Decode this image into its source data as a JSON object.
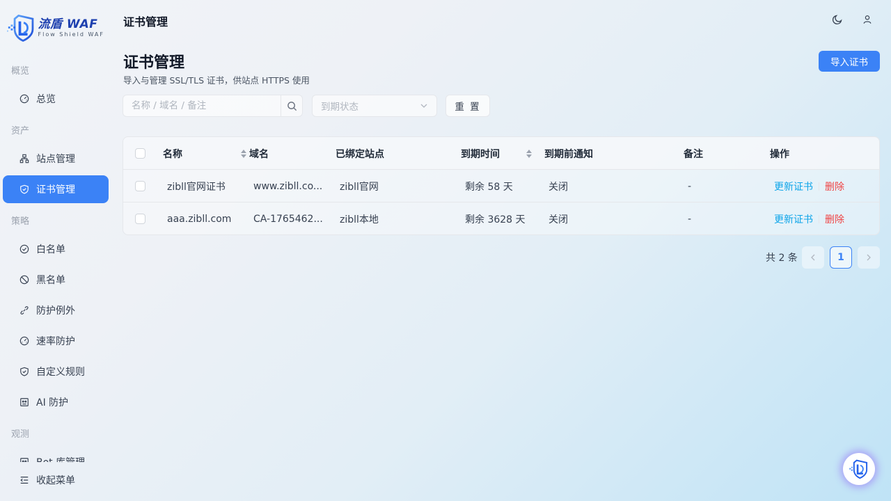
{
  "brand": {
    "title": "流盾 WAF",
    "subtitle": "Flow Shield WAF"
  },
  "sidebar": {
    "groups": [
      "概览",
      "资产",
      "策略",
      "观测"
    ],
    "items": [
      {
        "label": "总览",
        "icon": "dashboard-icon"
      },
      {
        "label": "站点管理",
        "icon": "sitemap-icon"
      },
      {
        "label": "证书管理",
        "icon": "shield-check-icon",
        "active": true
      },
      {
        "label": "白名单",
        "icon": "check-circle-icon"
      },
      {
        "label": "黑名单",
        "icon": "ban-icon"
      },
      {
        "label": "防护例外",
        "icon": "link-off-icon"
      },
      {
        "label": "速率防护",
        "icon": "gauge-icon"
      },
      {
        "label": "自定义规则",
        "icon": "shield-icon"
      },
      {
        "label": "AI 防护",
        "icon": "robot-icon"
      },
      {
        "label": "Bot 库管理",
        "icon": "bot-icon"
      }
    ],
    "collapse_label": "收起菜单"
  },
  "topbar": {
    "title": "证书管理"
  },
  "page": {
    "title": "证书管理",
    "subtitle": "导入与管理 SSL/TLS 证书，供站点 HTTPS 使用",
    "import_label": "导入证书"
  },
  "filters": {
    "search_placeholder": "名称 / 域名 / 备注",
    "status_placeholder": "到期状态",
    "reset_label": "重 置"
  },
  "table": {
    "columns": [
      "名称",
      "域名",
      "已绑定站点",
      "到期时间",
      "到期前通知",
      "备注",
      "操作"
    ],
    "rows": [
      {
        "name": "zibll官网证书",
        "domain": "www.zibll.co...",
        "site": "zibll官网",
        "expire": "剩余 58 天",
        "notify": "关闭",
        "remark": "-",
        "update": "更新证书",
        "delete": "删除"
      },
      {
        "name": "aaa.zibll.com",
        "domain": "CA-1765462...",
        "site": "zibll本地",
        "expire": "剩余 3628 天",
        "notify": "关闭",
        "remark": "-",
        "update": "更新证书",
        "delete": "删除"
      }
    ]
  },
  "pagination": {
    "total": "共 2 条",
    "current": "1"
  },
  "colors": {
    "accent": "#3b82f6",
    "link": "#0ea5e9",
    "danger": "#ef4444"
  }
}
